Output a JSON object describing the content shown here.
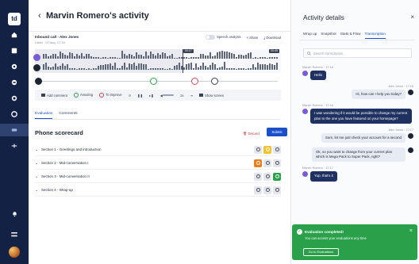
{
  "rail": {
    "logo_text": "td",
    "items": [
      "home-icon",
      "inbox-icon",
      "analytics-icon",
      "contacts-icon",
      "settings-icon",
      "reports-icon",
      "calls-icon",
      "integrations-icon"
    ],
    "active_index": 6
  },
  "header": {
    "back_glyph": "‹",
    "title": "Marvin Romero's activity"
  },
  "call": {
    "name": "Inbound call - Alex Jones",
    "meta": "Label · 07 aug, 17:16",
    "speech_analysis_label": "Speech analysis",
    "share_label": "Share",
    "download_label": "Download",
    "cursor_time": "00:17",
    "end_time": "00:45",
    "played_fraction": 0.6
  },
  "player": {
    "add_comment": "Add comment",
    "amazing": "Amazing",
    "to_improve": "To improve",
    "speed": "1x",
    "show_screen": "Show screen"
  },
  "tabs": {
    "evaluation": "Evaluation",
    "comments": "Comments"
  },
  "scorecard": {
    "title": "Phone scorecard",
    "discard": "Discard",
    "submit": "Submit",
    "sections": [
      {
        "label": "Section 1 - Greetings and introduction",
        "selected": 1,
        "selected_color": "yellow"
      },
      {
        "label": "Section 2 - Mid-conversation I",
        "selected": 0,
        "selected_color": "orange"
      },
      {
        "label": "Section 3 - Mid-conversation II",
        "selected": 2,
        "selected_color": "green"
      },
      {
        "label": "Section 4 - Wrap-up",
        "selected": -1,
        "selected_color": ""
      }
    ]
  },
  "panel": {
    "title": "Activity details",
    "close_glyph": "×",
    "tabs": [
      "Wrap up",
      "Snapshot",
      "Stats & Flow",
      "Transcription"
    ],
    "active_tab": 3,
    "search_placeholder": "Search transcription...",
    "messages": [
      {
        "who": "left",
        "head": "Marvin Romero · 17:16",
        "text": "Hello",
        "style": "dark"
      },
      {
        "who": "right",
        "head": "Alex Jones · 17:16",
        "text": "Hi, how can I help you today?",
        "style": "light"
      },
      {
        "who": "left",
        "head": "Marvin Romero · 17:16",
        "text": "I was wondering if it would be possible to change my current plan to the one you have featured on your homepage?",
        "style": "dark"
      },
      {
        "who": "right",
        "head": "Alex Jones · 17:17",
        "text": "Sure, let me just check your account for a second",
        "style": "light"
      },
      {
        "who": "right",
        "head": "",
        "text": "Ok, so you want to change from your current plan which is Mega Pack to Super Pack, right?",
        "style": "light"
      },
      {
        "who": "left",
        "head": "Marvin Romero · 17:17",
        "text": "Yup, that's it",
        "style": "dark"
      }
    ]
  },
  "toast": {
    "title": "Evaluation completed!",
    "message": "You can access your evaluations any time",
    "button": "Go to Evaluations",
    "close_glyph": "×"
  }
}
